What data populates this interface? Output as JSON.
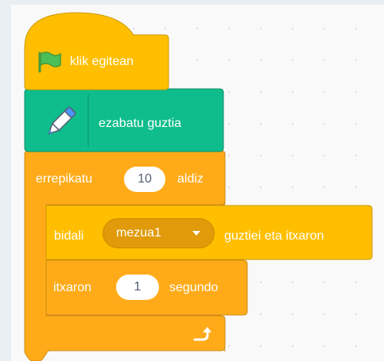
{
  "hat_block": {
    "label": "klik egitean",
    "icon": "green-flag-icon"
  },
  "pen_block": {
    "label": "ezabatu guztia",
    "icon": "pen-icon"
  },
  "repeat_block": {
    "label_before": "errepikatu",
    "count": "10",
    "label_after": "aldiz",
    "loop_icon": "loop-arrow-icon"
  },
  "broadcast_block": {
    "label_before": "bidali",
    "message": "mezua1",
    "label_after": "guztiei eta itxaron"
  },
  "wait_block": {
    "label_before": "itxaron",
    "seconds": "1",
    "label_after": "segundo"
  },
  "colors": {
    "events": "#ffbf00",
    "control": "#ffab19",
    "pen": "#0fbd8c",
    "flag": "#4cbf56"
  }
}
